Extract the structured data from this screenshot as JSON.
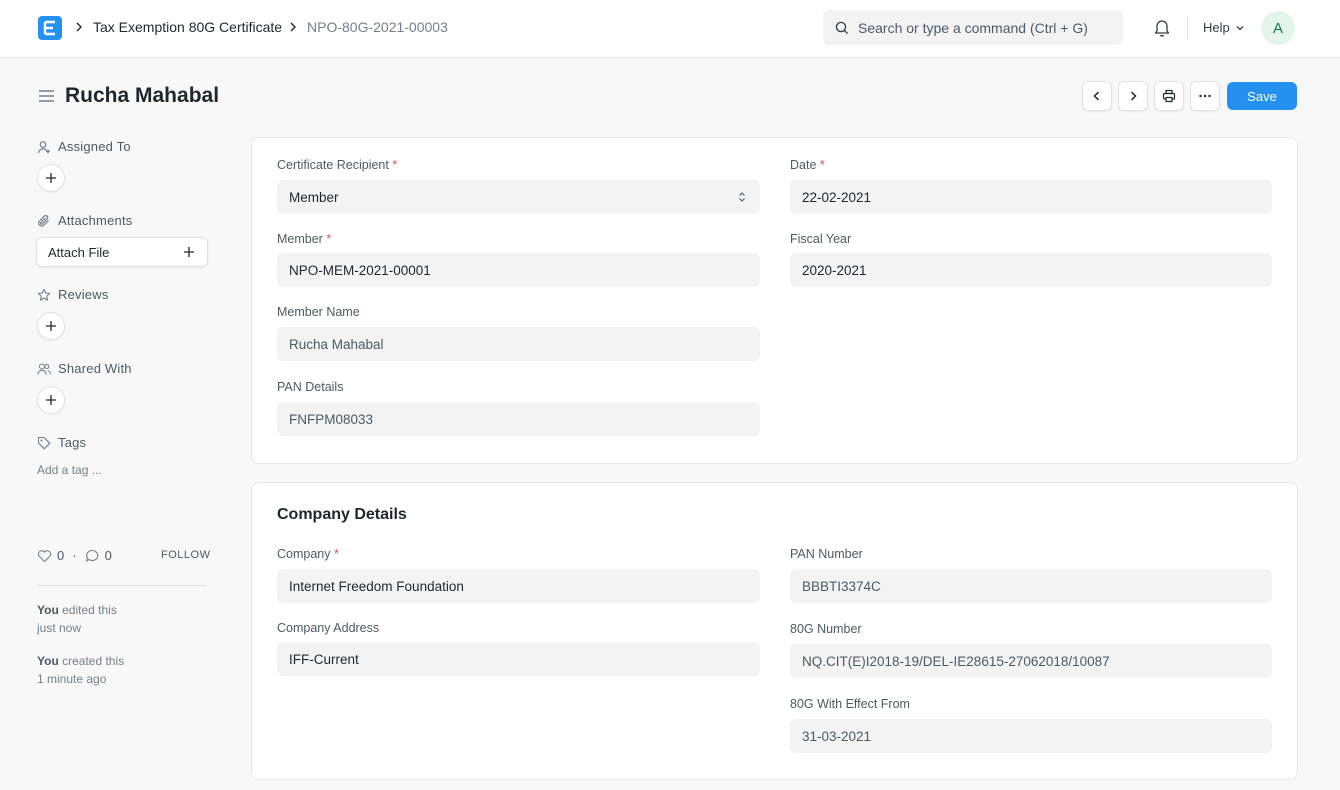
{
  "navbar": {
    "breadcrumb_1": "Tax Exemption 80G Certificate",
    "breadcrumb_2": "NPO-80G-2021-00003",
    "search_placeholder": "Search or type a command (Ctrl + G)",
    "help_label": "Help",
    "avatar_initial": "A"
  },
  "page": {
    "title": "Rucha Mahabal",
    "save_label": "Save"
  },
  "sidebar": {
    "assigned_to": "Assigned To",
    "attachments": "Attachments",
    "attach_file": "Attach File",
    "reviews": "Reviews",
    "shared_with": "Shared With",
    "tags": "Tags",
    "add_tag": "Add a tag ...",
    "likes": "0",
    "comments": "0",
    "dot": "·",
    "follow": "FOLLOW",
    "activity": [
      {
        "who": "You",
        "what": " edited this",
        "when": "just now"
      },
      {
        "who": "You",
        "what": " created this",
        "when": "1 minute ago"
      }
    ]
  },
  "form": {
    "certificate_recipient": {
      "label": "Certificate Recipient",
      "value": "Member"
    },
    "date": {
      "label": "Date",
      "value": "22-02-2021"
    },
    "member": {
      "label": "Member",
      "value": "NPO-MEM-2021-00001"
    },
    "fiscal_year": {
      "label": "Fiscal Year",
      "value": "2020-2021"
    },
    "member_name": {
      "label": "Member Name",
      "value": "Rucha Mahabal"
    },
    "pan_details": {
      "label": "PAN Details",
      "value": "FNFPM08033"
    },
    "required_mark": "*"
  },
  "company_section": {
    "title": "Company Details",
    "company": {
      "label": "Company",
      "value": "Internet Freedom Foundation"
    },
    "company_address": {
      "label": "Company Address",
      "value": "IFF-Current"
    },
    "pan_number": {
      "label": "PAN Number",
      "value": "BBBTI3374C"
    },
    "number_80g": {
      "label": "80G Number",
      "value": "NQ.CIT(E)I2018-19/DEL-IE28615-27062018/10087"
    },
    "effect_from": {
      "label": "80G With Effect From",
      "value": "31-03-2021"
    }
  },
  "colors": {
    "accent": "#2490ef",
    "required": "#e24c4c"
  }
}
